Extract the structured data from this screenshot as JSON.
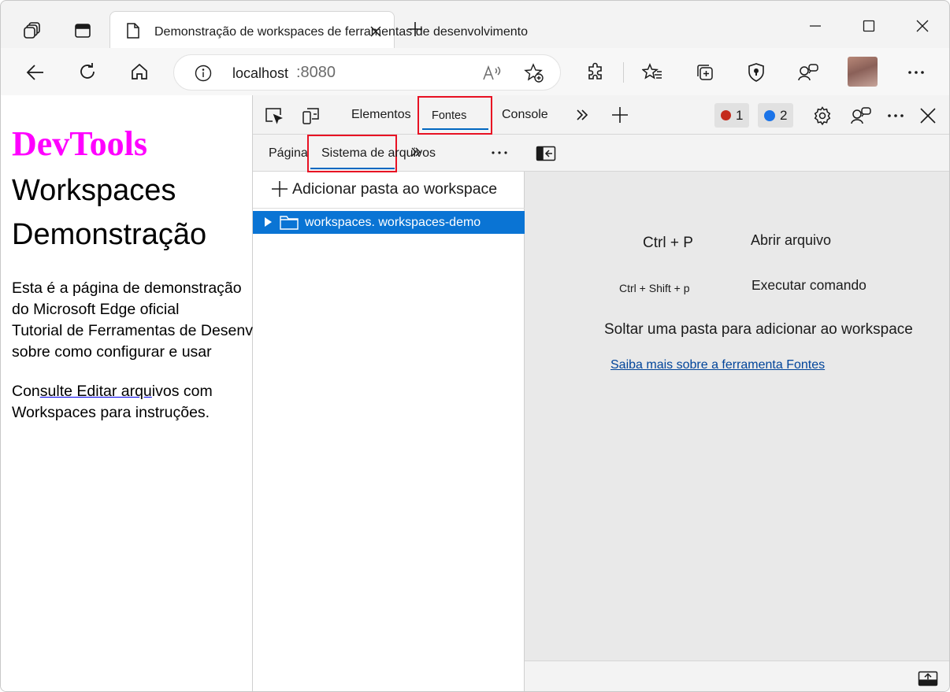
{
  "browser": {
    "tab_title": "Demonstração de workspaces de ferramentas de desenvolvimento",
    "address_host": "localhost",
    "address_port": ":8080"
  },
  "page": {
    "heading": "DevTools",
    "subheading_1": "Workspaces",
    "subheading_2": "Demonstração",
    "para_lines": [
      "Esta é a página de demonstração",
      "do Microsoft Edge oficial",
      "Tutorial de Ferramentas de Desenvolvimento",
      "sobre como configurar e usar"
    ],
    "para2_prefix": "Con",
    "para2_link": "sulte Editar arqu",
    "para2_suffix": "ivos com",
    "para2_line2": "Workspaces para instruções."
  },
  "devtools": {
    "tabs": {
      "elements": "Elementos",
      "sources": "Fontes",
      "console": "Console"
    },
    "error_count": "1",
    "message_count": "2",
    "navigator": {
      "tab_page": "Página",
      "tab_filesystem": "Sistema de arquivos",
      "add_folder": "Adicionar pasta ao workspace",
      "folder_name": "workspaces. workspaces-demo"
    },
    "editor": {
      "shortcut_1_keys": "Ctrl + P",
      "shortcut_1_label": "Abrir arquivo",
      "shortcut_2_keys": "Ctrl + Shift + p",
      "shortcut_2_label": "Executar comando",
      "drop_hint": "Soltar uma pasta para adicionar ao workspace",
      "learn_more": "Saiba mais sobre a ferramenta Fontes"
    }
  },
  "colors": {
    "heading": "#ff00ff",
    "selection": "#0a74d4",
    "highlight_box": "#e81123"
  }
}
